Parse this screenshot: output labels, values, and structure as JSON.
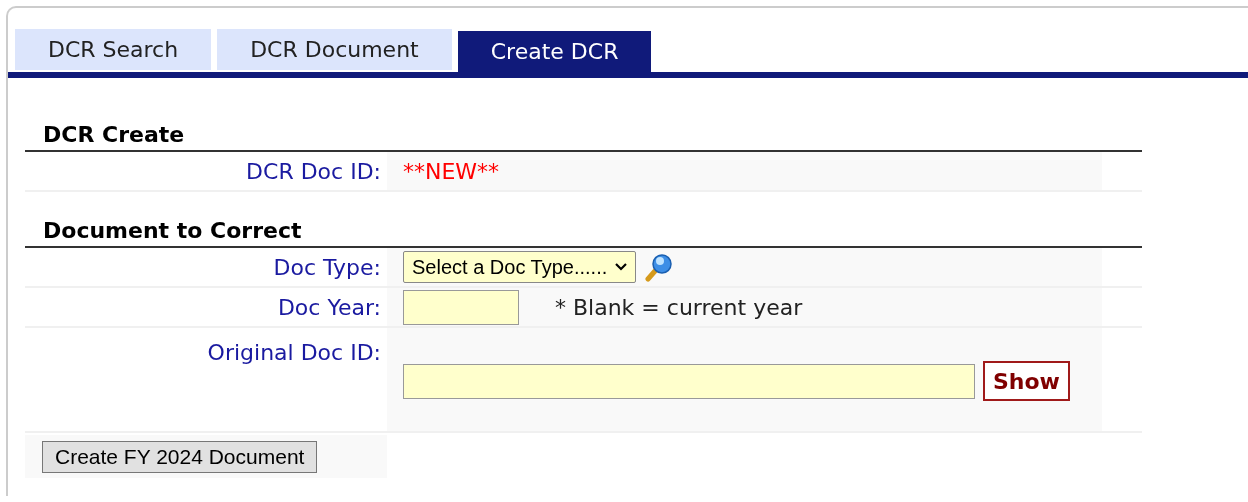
{
  "tabs": [
    {
      "label": "DCR Search",
      "selected": false
    },
    {
      "label": "DCR Document",
      "selected": false
    },
    {
      "label": "Create DCR",
      "selected": true
    }
  ],
  "sections": [
    {
      "title": "DCR Create",
      "rows": [
        {
          "kind": "readonly",
          "label": "DCR Doc ID:",
          "value": "**NEW**"
        }
      ]
    },
    {
      "title": "Document to Correct",
      "rows": [
        {
          "kind": "select",
          "label": "Doc Type:",
          "value": "Select a Doc Type......"
        },
        {
          "kind": "year",
          "label": "Doc Year:",
          "note": "* Blank = current year"
        },
        {
          "kind": "docid",
          "label": "Original Doc ID:",
          "button": "Show"
        }
      ]
    }
  ],
  "create_button": "Create FY 2024 Document"
}
